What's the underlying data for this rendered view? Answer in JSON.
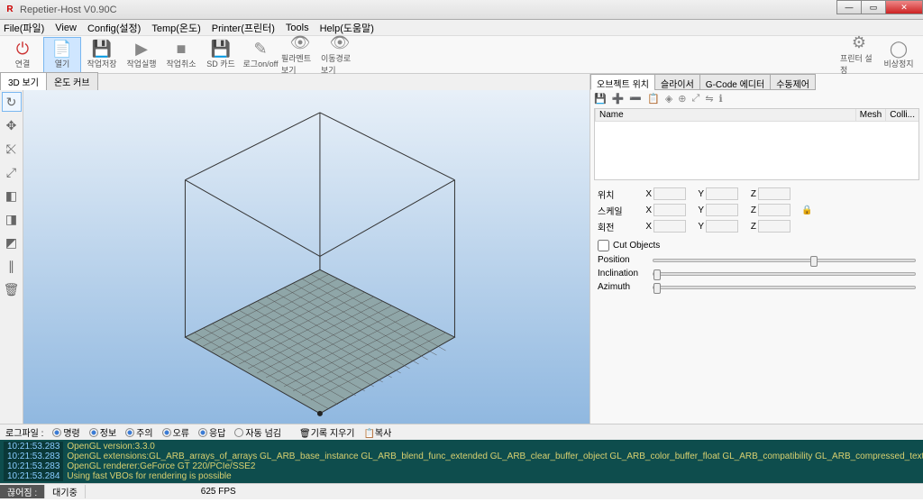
{
  "titlebar": {
    "title": "Repetier-Host V0.90C"
  },
  "menu": [
    "File(파일)",
    "View",
    "Config(설정)",
    "Temp(온도)",
    "Printer(프린터)",
    "Tools",
    "Help(도움말)"
  ],
  "toolbar": {
    "items": [
      {
        "icon": "⏻",
        "label": "연결",
        "cls": "red"
      },
      {
        "icon": "📄",
        "label": "열기",
        "cls": "sel"
      },
      {
        "icon": "💾",
        "label": "작업저장"
      },
      {
        "icon": "▶",
        "label": "작업실행"
      },
      {
        "icon": "■",
        "label": "작업취소"
      },
      {
        "icon": "💾",
        "label": "SD 카드"
      },
      {
        "icon": "✎",
        "label": "로그on/off"
      },
      {
        "icon": "👁",
        "label": "필라멘트 보기"
      },
      {
        "icon": "👁",
        "label": "이동경로 보기"
      }
    ],
    "right": [
      {
        "icon": "⚙",
        "label": "프린터 설정"
      },
      {
        "icon": "◯",
        "label": "비상정지",
        "cls": "red"
      }
    ]
  },
  "view_tabs": [
    "3D 보기",
    "온도 커브"
  ],
  "side_tools": [
    "↻",
    "✥",
    "⤪",
    "⤢",
    "◧",
    "◨",
    "◩",
    "∥",
    "🗑"
  ],
  "right_tabs": [
    "오브젝트 위치",
    "슬라이서",
    "G-Code 에디터",
    "수동제어"
  ],
  "object_list": {
    "cols": [
      "Name",
      "Mesh",
      "Colli..."
    ]
  },
  "transform": {
    "rows": [
      {
        "label": "위치",
        "x": "",
        "y": "",
        "z": ""
      },
      {
        "label": "스케일",
        "x": "",
        "y": "",
        "z": ""
      },
      {
        "label": "회전",
        "x": "",
        "y": "",
        "z": ""
      }
    ],
    "lock_icon": "🔒"
  },
  "cut_objects": "Cut Objects",
  "sliders": [
    {
      "label": "Position",
      "pos": 60
    },
    {
      "label": "Inclination",
      "pos": 0
    },
    {
      "label": "Azimuth",
      "pos": 0
    }
  ],
  "logbar": {
    "label": "로그파일 :",
    "filters": [
      "명령",
      "정보",
      "주의",
      "오류",
      "응답",
      "자동 넘김"
    ],
    "actions": [
      "기록 지우기",
      "복사"
    ],
    "clear_icon": "🗑",
    "copy_icon": "📋"
  },
  "log_lines": [
    {
      "ts": "10:21:53.283",
      "msg": "OpenGL version:3.3.0"
    },
    {
      "ts": "10:21:53.283",
      "msg": "OpenGL extensions:GL_ARB_arrays_of_arrays GL_ARB_base_instance GL_ARB_blend_func_extended GL_ARB_clear_buffer_object GL_ARB_color_buffer_float GL_ARB_compatibility GL_ARB_compressed_texture_pixel_sto"
    },
    {
      "ts": "10:21:53.283",
      "msg": "OpenGL renderer:GeForce GT 220/PCIe/SSE2"
    },
    {
      "ts": "10:21:53.284",
      "msg": "Using fast VBOs for rendering is possible"
    }
  ],
  "status": {
    "left": "끊어짐 :",
    "wait": "대기중",
    "fps": "625 FPS"
  }
}
